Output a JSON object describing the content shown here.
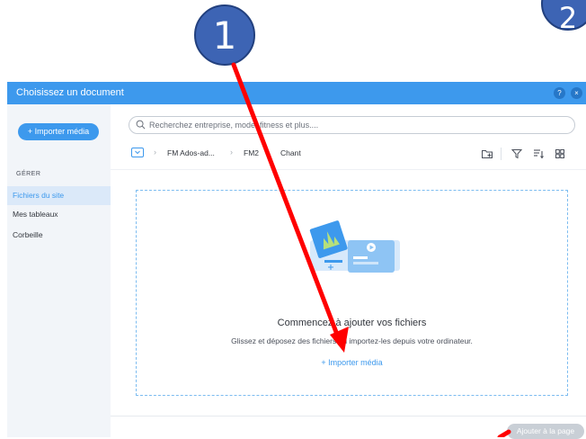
{
  "callouts": [
    {
      "number": "1"
    },
    {
      "number": "2"
    }
  ],
  "dialog": {
    "title": "Choisissez un document",
    "help_label": "?",
    "close_label": "×"
  },
  "sidebar": {
    "import_button": "+ Importer média",
    "section_label": "GÉRER",
    "items": [
      {
        "label": "Fichiers du site",
        "active": true
      },
      {
        "label": "Mes tableaux",
        "active": false
      },
      {
        "label": "Corbeille",
        "active": false
      }
    ]
  },
  "search": {
    "placeholder": "Recherchez entreprise, mode, fitness et plus....",
    "value": ""
  },
  "breadcrumb": {
    "items": [
      "FM Ados-ad...",
      "FM2",
      "Chant"
    ],
    "separator": "›"
  },
  "empty_state": {
    "title": "Commencez à ajouter vos fichiers",
    "subtitle": "Glissez et déposez des fichiers ou importez-les depuis votre ordinateur.",
    "link": "+ Importer média"
  },
  "footer": {
    "add_button": "Ajouter à la page"
  },
  "colors": {
    "accent": "#3d99ed",
    "sidebar_bg": "#f2f5f9",
    "active_item_bg": "#dbe9f9",
    "callout_fill": "#3d64b4",
    "arrow": "#ff0000",
    "disabled_button": "#c9cfd6"
  },
  "icons": {
    "toolbar": [
      "new-folder-icon",
      "filter-icon",
      "sort-icon",
      "grid-view-icon"
    ]
  }
}
